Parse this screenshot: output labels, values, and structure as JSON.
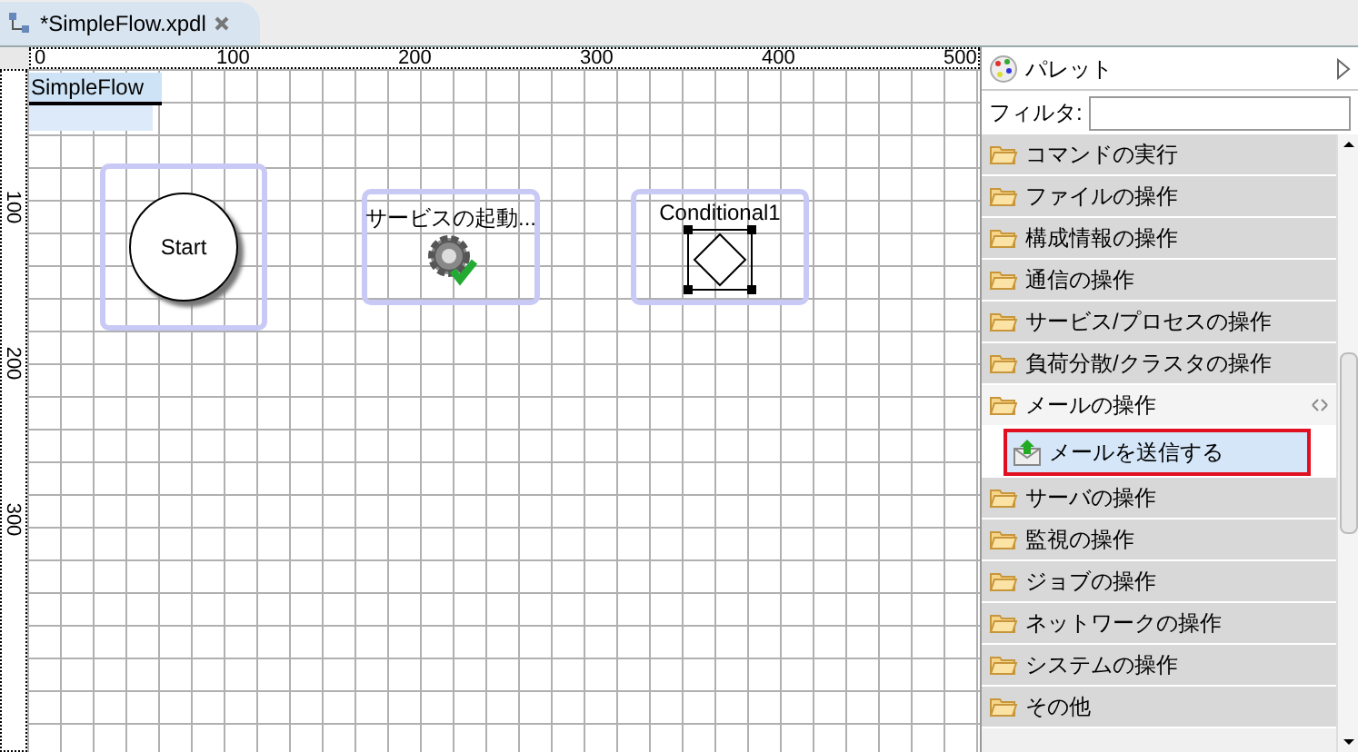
{
  "tab": {
    "title": "*SimpleFlow.xpdl"
  },
  "ruler": {
    "top_labels": [
      "0",
      "100",
      "200",
      "300",
      "400",
      "500"
    ],
    "left_labels": [
      "100",
      "200",
      "300"
    ]
  },
  "canvas": {
    "title": "SimpleFlow",
    "nodes": [
      {
        "kind": "start",
        "label": "Start"
      },
      {
        "kind": "service",
        "label": "サービスの起動..."
      },
      {
        "kind": "conditional",
        "label": "Conditional1",
        "selected": true
      }
    ]
  },
  "palette": {
    "title": "パレット",
    "filter": {
      "label": "フィルタ:"
    },
    "drawers": [
      {
        "label": "コマンドの実行",
        "expanded": false
      },
      {
        "label": "ファイルの操作",
        "expanded": false
      },
      {
        "label": "構成情報の操作",
        "expanded": false
      },
      {
        "label": "通信の操作",
        "expanded": false
      },
      {
        "label": "サービス/プロセスの操作",
        "expanded": false
      },
      {
        "label": "負荷分散/クラスタの操作",
        "expanded": false
      },
      {
        "label": "メールの操作",
        "expanded": true,
        "children": [
          {
            "label": "メールを送信する",
            "selected": true,
            "highlighted": true
          }
        ]
      },
      {
        "label": "サーバの操作",
        "expanded": false
      },
      {
        "label": "監視の操作",
        "expanded": false
      },
      {
        "label": "ジョブの操作",
        "expanded": false
      },
      {
        "label": "ネットワークの操作",
        "expanded": false
      },
      {
        "label": "システムの操作",
        "expanded": false
      },
      {
        "label": "その他",
        "expanded": false
      }
    ]
  }
}
